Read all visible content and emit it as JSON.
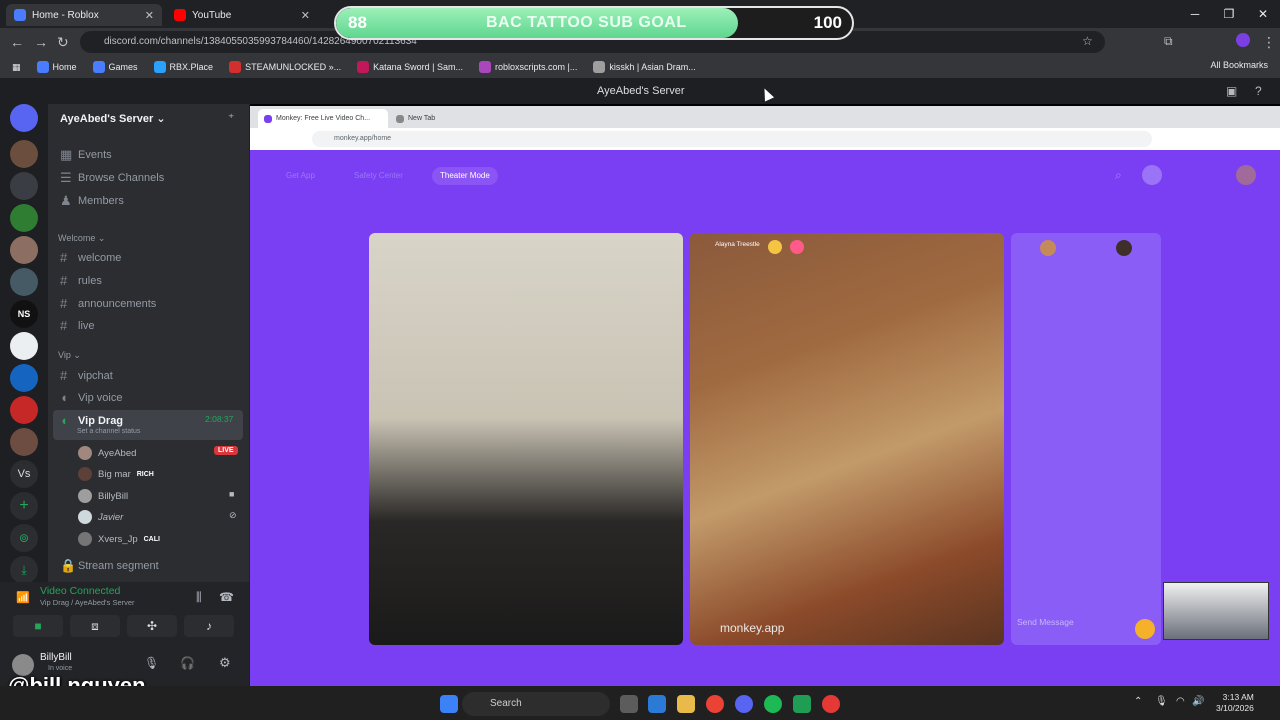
{
  "browser": {
    "tabs": [
      {
        "label": "Home - Roblox"
      },
      {
        "label": "YouTube"
      }
    ],
    "url": "discord.com/channels/1384055035993784460/1428264900702113634",
    "bookmarks": [
      "Home",
      "Games",
      "RBX.Place",
      "STEAMUNLOCKED »...",
      "Katana Sword | Sam...",
      "robloxscripts.com |...",
      "kisskh | Asian Dram..."
    ],
    "all_bookmarks": "All Bookmarks"
  },
  "goal_overlay": {
    "start": "88",
    "title": "BAC TATTOO SUB GOAL",
    "end": "100",
    "progress": 0.78
  },
  "discord": {
    "window_title": "AyeAbed's Server",
    "server_name": "AyeAbed's Server",
    "top_items": [
      "Events",
      "Browse Channels",
      "Members"
    ],
    "welcome_category": "Welcome",
    "welcome_channels": [
      "welcome",
      "rules",
      "announcements",
      "live"
    ],
    "vip_category": "Vip",
    "vip_channels": [
      "vipchat",
      "Vip voice"
    ],
    "active_voice": {
      "name": "Vip Drag",
      "timer": "2:08:37",
      "status_hint": "Set a channel status"
    },
    "voice_users": [
      {
        "name": "AyeAbed",
        "badge": "LIVE"
      },
      {
        "name": "Big mar",
        "badge": "RICH"
      },
      {
        "name": "BillyBill",
        "badge": ""
      },
      {
        "name": "Javier",
        "badge": ""
      },
      {
        "name": "Xvers_Jp",
        "badge": "CALI"
      }
    ],
    "extra_channel": "Stream segment",
    "voice_panel": {
      "status": "Video Connected",
      "location": "Vip Drag / AyeAbed's Server"
    },
    "user": {
      "name": "BillyBill",
      "status": "In voice"
    }
  },
  "inner_browser": {
    "tabs": [
      "Monkey: Free Live Video Ch...",
      "New Tab"
    ],
    "url": "monkey.app/home",
    "toolbar": [
      "Get App",
      "Safety Center",
      "Theater Mode"
    ],
    "remote_user": "Alayna Treestle",
    "watermark": "monkey.app",
    "chat_placeholder": "Send Message"
  },
  "overlay_handle": "@bill.nguyen",
  "taskbar": {
    "search": "Search",
    "time": "3:13 AM",
    "date": "3/10/2026"
  }
}
